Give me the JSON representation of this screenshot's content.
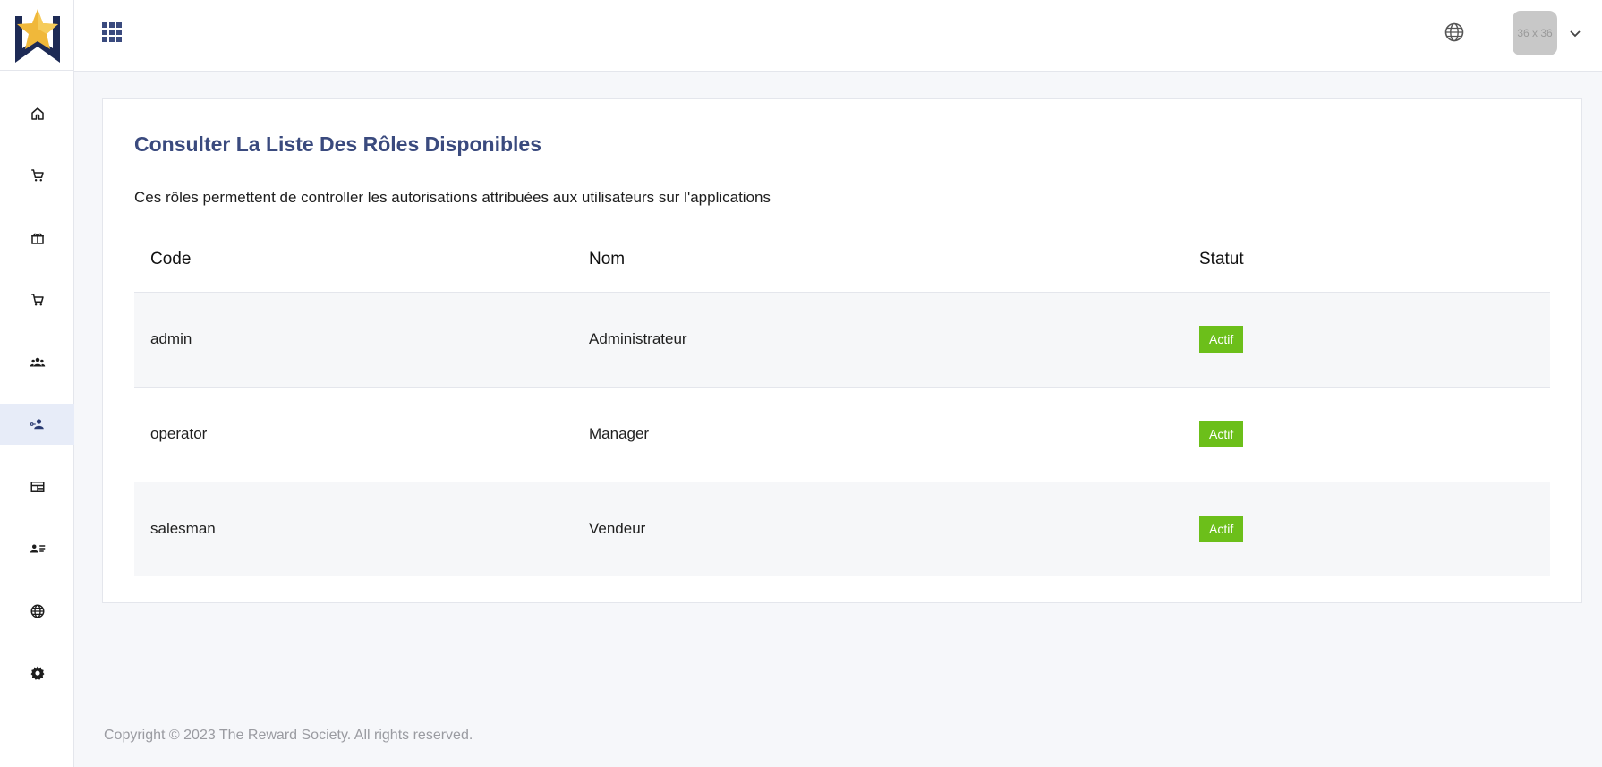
{
  "sidebar": {
    "items": [
      {
        "icon": "home-icon",
        "name": "sidebar-item-home"
      },
      {
        "icon": "cart-icon",
        "name": "sidebar-item-cart"
      },
      {
        "icon": "gift-icon",
        "name": "sidebar-item-gifts"
      },
      {
        "icon": "cart-icon",
        "name": "sidebar-item-orders"
      },
      {
        "icon": "group-icon",
        "name": "sidebar-item-groups"
      },
      {
        "icon": "user-roles-icon",
        "name": "sidebar-item-roles",
        "active": true
      },
      {
        "icon": "table-icon",
        "name": "sidebar-item-table"
      },
      {
        "icon": "user-list-icon",
        "name": "sidebar-item-user-list"
      },
      {
        "icon": "globe-icon",
        "name": "sidebar-item-language"
      },
      {
        "icon": "gear-icon",
        "name": "sidebar-item-settings"
      }
    ]
  },
  "header": {
    "avatar_text": "36 x 36"
  },
  "main": {
    "title": "Consulter La Liste Des Rôles Disponibles",
    "description": "Ces rôles permettent de controller les autorisations attribuées aux utilisateurs sur l'applications",
    "table": {
      "columns": [
        "Code",
        "Nom",
        "Statut"
      ],
      "rows": [
        {
          "code": "admin",
          "nom": "Administrateur",
          "statut": "Actif"
        },
        {
          "code": "operator",
          "nom": "Manager",
          "statut": "Actif"
        },
        {
          "code": "salesman",
          "nom": "Vendeur",
          "statut": "Actif"
        }
      ]
    }
  },
  "footer": {
    "copyright": "Copyright © 2023 The Reward Society. All rights reserved."
  },
  "colors": {
    "accent": "#3a4a7e",
    "status_active": "#6cbf1a",
    "active_nav_bg": "#e7ecf8"
  }
}
